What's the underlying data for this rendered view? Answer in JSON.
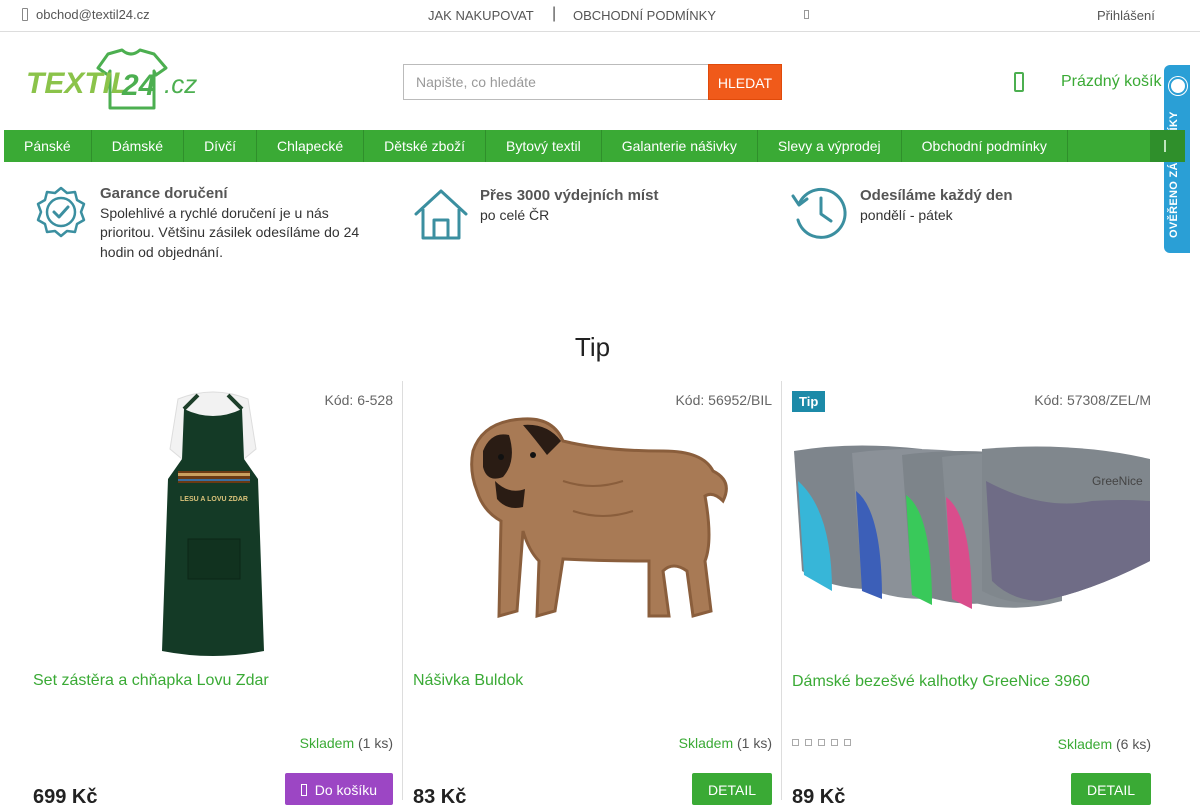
{
  "topbar": {
    "email": "obchod@textil24.cz",
    "nav": [
      "JAK NAKUPOVAT",
      "OBCHODNÍ PODMÍNKY"
    ],
    "separator": "|",
    "login": "Přihlášení"
  },
  "header": {
    "logo_text": "TEXTIL24.cz",
    "search": {
      "placeholder": "Napište, co hledáte",
      "button": "HLEDAT"
    },
    "cart": "Prázdný košík",
    "side_badge": "OVĚŘENO ZÁKAZNÍKY"
  },
  "nav": [
    "Pánské",
    "Dámské",
    "Dívčí",
    "Chlapecké",
    "Dětské zboží",
    "Bytový textil",
    "Galanterie nášivky",
    "Slevy a výprodej",
    "Obchodní podmínky"
  ],
  "benefits": [
    {
      "title": "Garance doručení",
      "text": "Spolehlivé a rychlé doručení je u nás prioritou. Většinu zásilek odesíláme do 24 hodin od objednání.",
      "icon": "badge-check-icon"
    },
    {
      "title": "Přes 3000 výdejních míst",
      "text": "po celé ČR",
      "icon": "house-icon"
    },
    {
      "title": "Odesíláme každý den",
      "text": "pondělí - pátek",
      "icon": "clock-history-icon"
    }
  ],
  "section": {
    "title": "Tip"
  },
  "products": [
    {
      "code": "Kód: 6-528",
      "name": "Set zástěra a chňapka Lovu Zdar",
      "stock_label": "Skladem",
      "stock_qty": "(1 ks)",
      "price": "699 Kč",
      "button": "Do košíku",
      "apron_text": "LESU A LOVU ZDAR"
    },
    {
      "code": "Kód: 56952/BIL",
      "name": "Nášivka Buldok",
      "stock_label": "Skladem",
      "stock_qty": "(1 ks)",
      "price": "83 Kč",
      "button": "DETAIL"
    },
    {
      "code": "Kód: 57308/ZEL/M",
      "name": "Dámské bezešvé kalhotky GreeNice 3960",
      "badge": "Tip",
      "stock_label": "Skladem",
      "stock_qty": "(6 ks)",
      "price": "89 Kč",
      "button": "DETAIL",
      "brand_text": "GreeNice"
    }
  ],
  "colors": {
    "accent": "#3aaa35",
    "search_button": "#f05a1a",
    "cart_button": "#9c46c4",
    "tip_badge": "#1c8aa8"
  }
}
